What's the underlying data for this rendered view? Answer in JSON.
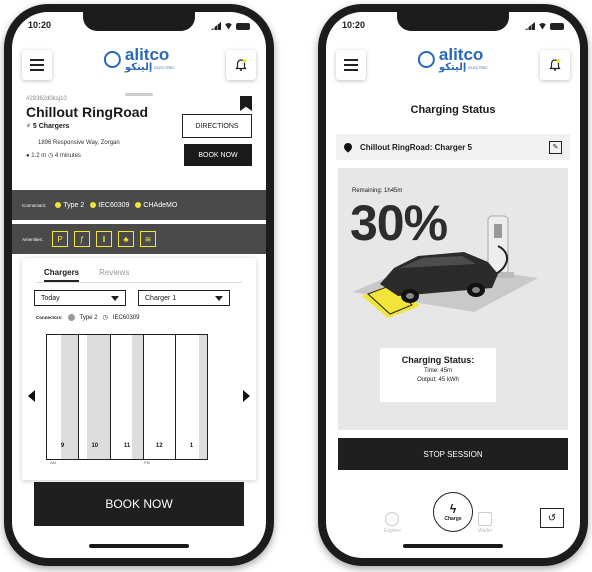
{
  "left": {
    "status_time": "10:20",
    "logo": {
      "en": "alitco",
      "ar": "إليتكو",
      "small": "ELECTRIC"
    },
    "station": {
      "id": "#29362d0ksj10",
      "name": "Chillout RingRoad",
      "chargers": "5 Chargers",
      "address": "1896 Responsive Way, Zorgan",
      "distance": "1.2 m",
      "time": "4 minutes",
      "directions_label": "DIRECTIONS",
      "book_label": "BOOK NOW"
    },
    "connectors": {
      "label": "Connectors:",
      "items": [
        "Type 2",
        "IEC60309",
        "CHAdeMO"
      ]
    },
    "amenities": {
      "label": "Amenities:",
      "icons": [
        "parking-icon",
        "restaurant-icon",
        "restroom-icon",
        "park-icon",
        "wifi-icon"
      ]
    },
    "panel": {
      "tabs": [
        "Chargers",
        "Reviews"
      ],
      "date_select": "Today",
      "charger_select": "Charger 1",
      "connectors_label": "Connectors:",
      "connectors": [
        "Type 2",
        "IEC60309"
      ],
      "slots": [
        {
          "num": "9",
          "shade": 0.55
        },
        {
          "num": "10",
          "shade": 0.75
        },
        {
          "num": "11",
          "shade": 0.35
        },
        {
          "num": "12",
          "shade": 0
        },
        {
          "num": "1",
          "shade": 0.25
        }
      ],
      "am": "AM",
      "pm": "PM"
    },
    "book_now_label": "BOOK NOW"
  },
  "right": {
    "status_time": "10:20",
    "logo": {
      "en": "alitco",
      "ar": "إليتكو",
      "small": "ELECTRIC"
    },
    "title": "Charging Status",
    "location": "Chillout RingRoad: Charger 5",
    "remaining": "Remaining: 1h45m",
    "percent": "30%",
    "info": {
      "title": "Charging Status:",
      "time": "Time: 45m",
      "output": "Output: 45 kWh"
    },
    "stop_label": "STOP SESSION",
    "nav": {
      "explore": "Explore",
      "charge": "Charge",
      "wallet": "Wallet"
    }
  }
}
